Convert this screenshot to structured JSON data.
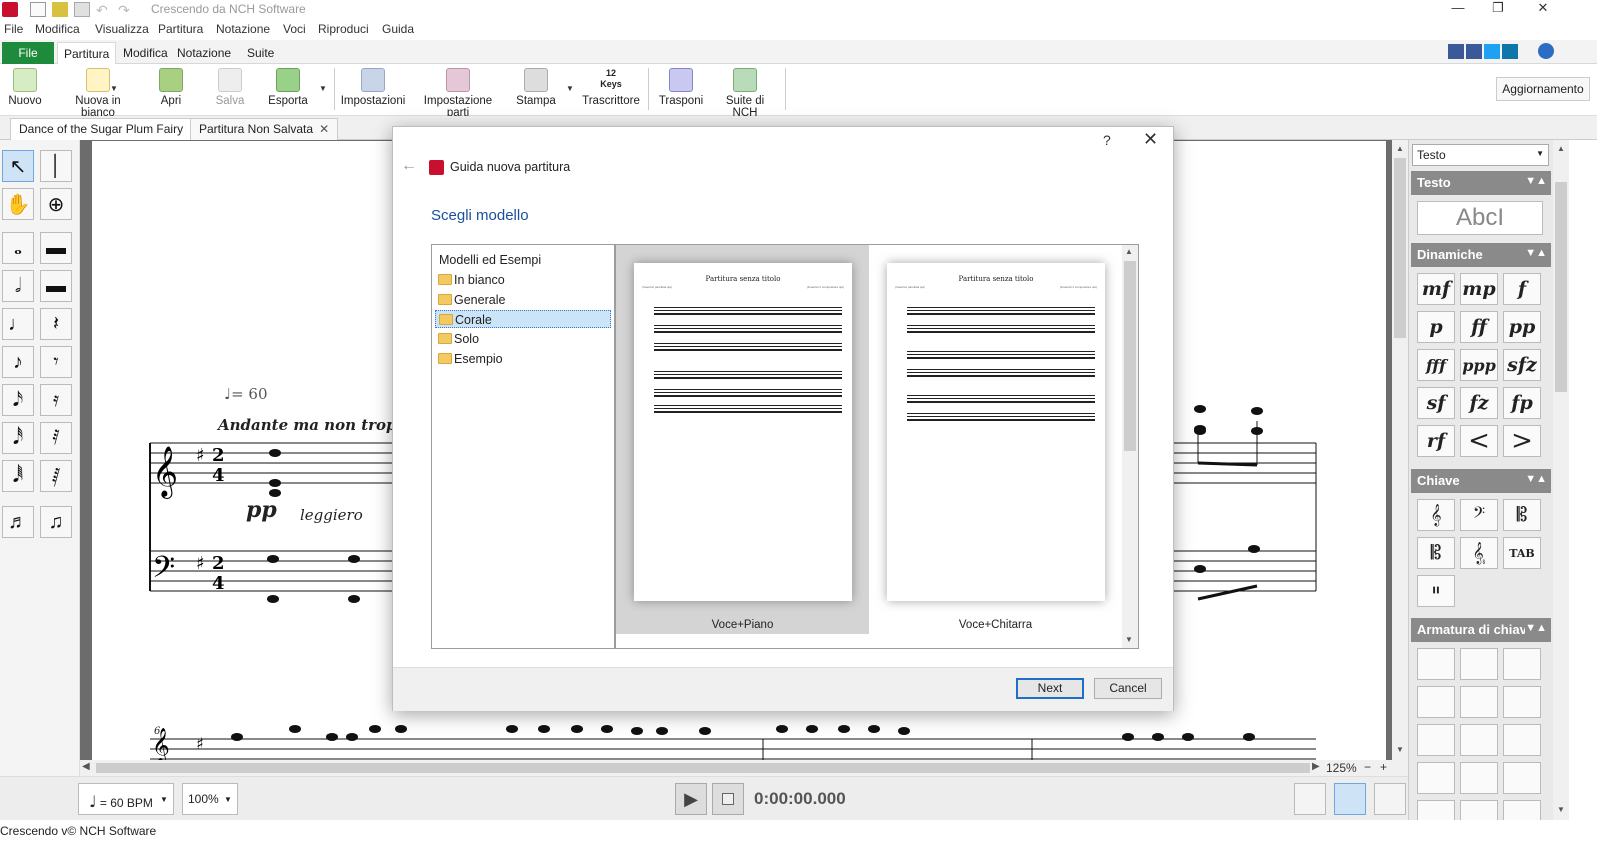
{
  "window": {
    "title": "Crescendo da NCH Software",
    "minimize": "—",
    "restore": "❐",
    "close": "✕"
  },
  "menu": [
    "File",
    "Modifica",
    "Visualizza",
    "Partitura",
    "Notazione",
    "Voci",
    "Riproduci",
    "Guida"
  ],
  "ribbon_tabs": {
    "file": "File",
    "items": [
      "Partitura",
      "Modifica",
      "Notazione",
      "Suite"
    ],
    "active": "Partitura"
  },
  "ribbon": {
    "buttons": [
      {
        "label": "Nuovo"
      },
      {
        "label": "Nuova in bianco"
      },
      {
        "label": "Apri"
      },
      {
        "label": "Salva"
      },
      {
        "label": "Esporta"
      },
      {
        "label": "Impostazioni"
      },
      {
        "label": "Impostazione parti"
      },
      {
        "label": "Stampa"
      },
      {
        "label": "Trascrittore"
      },
      {
        "label": "Trasponi"
      },
      {
        "label": "Suite di NCH"
      }
    ],
    "keys_icon_text": "12 Keys",
    "update": "Aggiornamento"
  },
  "doc_tabs": [
    {
      "label": "Dance of the Sugar Plum Fairy",
      "close": "✕"
    },
    {
      "label": "Partitura Non Salvata",
      "close": "✕"
    }
  ],
  "score": {
    "tempo": "= 60",
    "tempo_text": "Andante ma non troppo",
    "dynamic": "pp",
    "expression": "leggiero",
    "measure_number": "6"
  },
  "transport": {
    "tempo_bpm": "= 60 BPM",
    "zoom": "100%",
    "time": "0:00:00.000",
    "page_zoom": "125%"
  },
  "status": {
    "text": "Crescendo v© NCH Software"
  },
  "right_panel": {
    "dropdown": "Testo",
    "sections": {
      "testo": "Testo",
      "dinamiche": "Dinamiche",
      "chiave": "Chiave",
      "armatura": "Armatura di chiave"
    },
    "text_sample": "AbcI",
    "dynamics": [
      "mf",
      "mp",
      "f",
      "p",
      "ff",
      "pp",
      "fff",
      "ppp",
      "sfz",
      "sf",
      "fz",
      "fp",
      "rf",
      "<",
      ">"
    ]
  },
  "dialog": {
    "help": "?",
    "close": "✕",
    "back": "←",
    "title": "Guida nuova partitura",
    "heading": "Scegli modello",
    "tree_root": "Modelli ed Esempi",
    "folders": [
      "In bianco",
      "Generale",
      "Corale",
      "Solo",
      "Esempio"
    ],
    "selected_folder": "Corale",
    "templates": [
      {
        "name": "Voce+Piano",
        "page_title": "Partitura senza titolo",
        "left_caption": "(Inserisci parolista qui)",
        "right_caption": "(Inserisci il compositore qui)"
      },
      {
        "name": "Voce+Chitarra",
        "page_title": "Partitura senza titolo",
        "left_caption": "(Inserisci parolista qui)",
        "right_caption": "(Inserisci il compositore qui)"
      }
    ],
    "next": "Next",
    "cancel": "Cancel"
  },
  "colors": {
    "file_tab": "#1e8a3b",
    "dialog_heading": "#1b4f9c",
    "selection": "#cce4f7",
    "primary_border": "#1f6fc6"
  }
}
